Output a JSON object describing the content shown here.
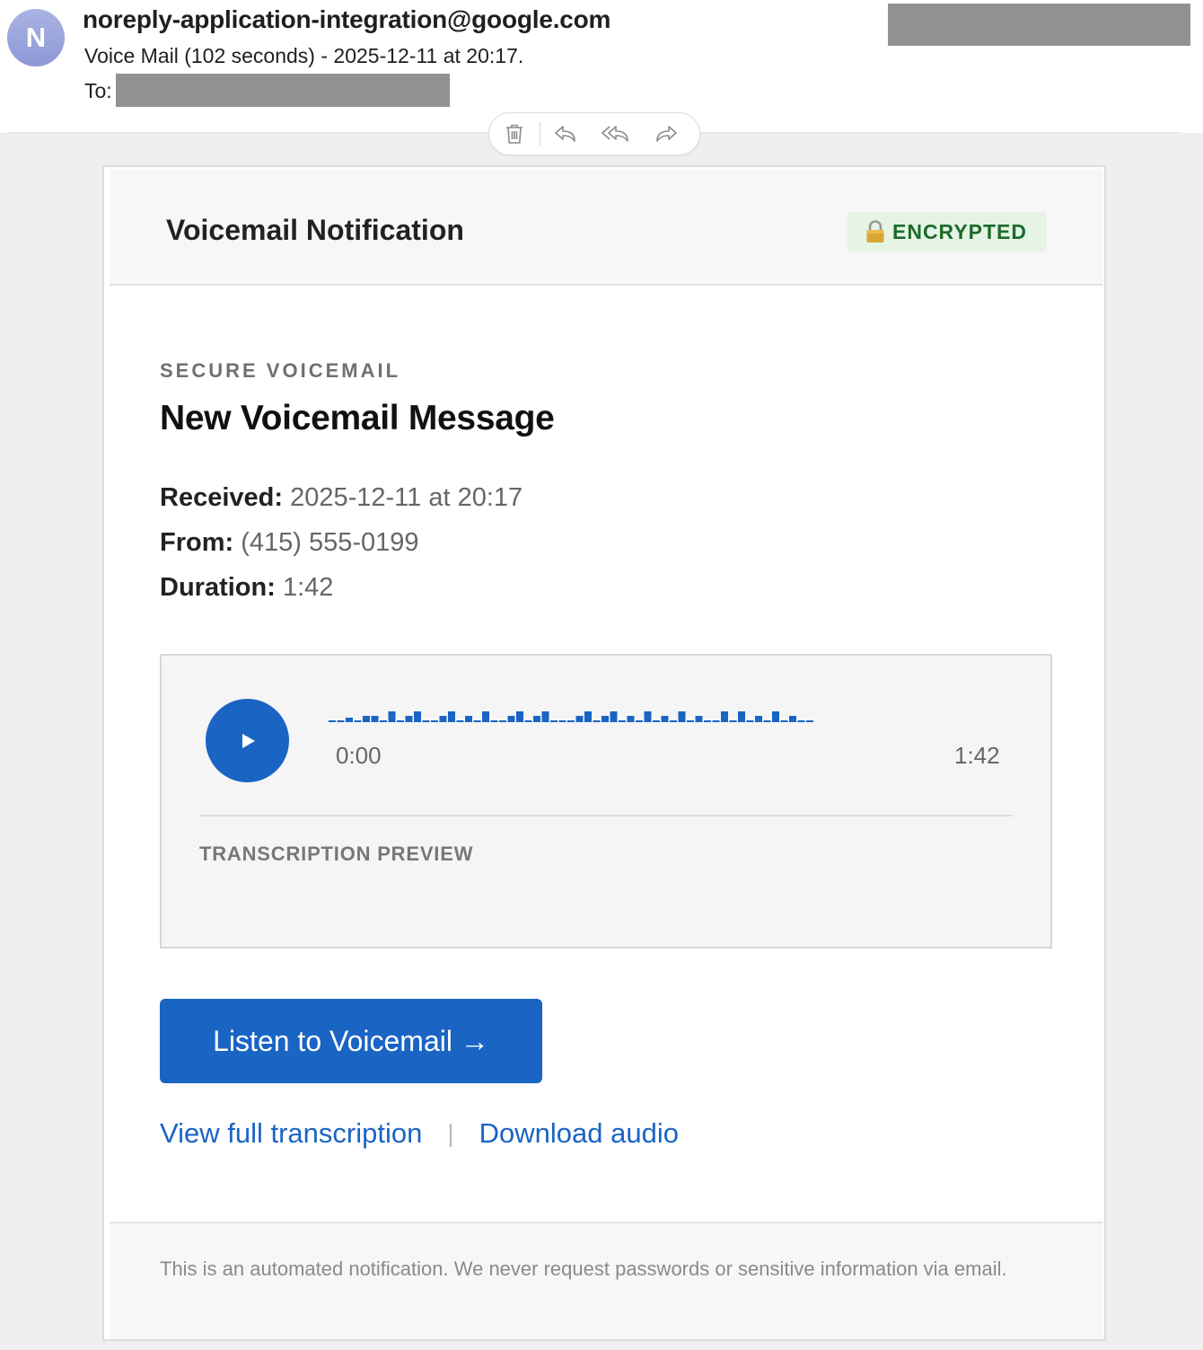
{
  "mail": {
    "sender": "noreply-application-integration@google.com",
    "avatar_initial": "N",
    "subject": "Voice Mail (102 seconds) - 2025-12-11 at 20:17.",
    "to_label": "To:"
  },
  "toolbar": {
    "icons": [
      "trash-icon",
      "reply-icon",
      "reply-all-icon",
      "forward-icon"
    ]
  },
  "email": {
    "header_title": "Voicemail Notification",
    "badge_label": "ENCRYPTED",
    "badge_icon": "lock-icon",
    "eyebrow": "SECURE VOICEMAIL",
    "headline": "New Voicemail Message",
    "received_label": "Received:",
    "received_value": "2025-12-11 at 20:17",
    "from_label": "From:",
    "from_value": "(415) 555-0199",
    "duration_label": "Duration:",
    "duration_value": "1:42",
    "player": {
      "time_start": "0:00",
      "time_end": "1:42",
      "transcription_label": "TRANSCRIPTION PREVIEW"
    },
    "cta_label": "Listen to Voicemail →",
    "link_transcription": "View full transcription",
    "link_separator": "|",
    "link_download": "Download audio",
    "footer_text": "This is an automated notification. We never request passwords or sensitive information via email."
  },
  "colors": {
    "accent_blue": "#1a64c4",
    "badge_bg": "#e5f4e5",
    "badge_text": "#1d6b2a",
    "redaction": "#919191",
    "avatar": "#8d98d6"
  }
}
